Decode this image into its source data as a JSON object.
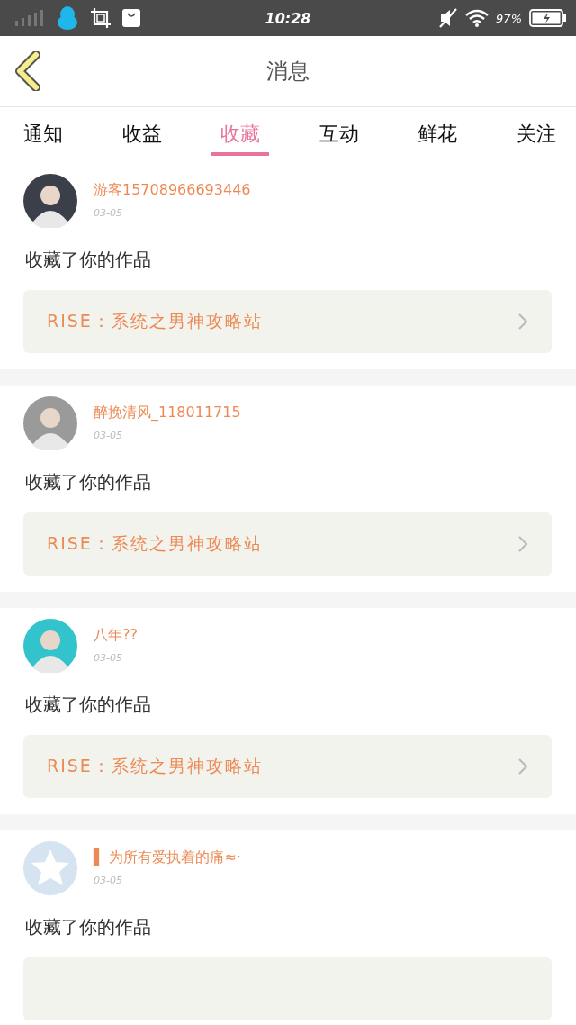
{
  "status_bar": {
    "time": "10:28",
    "battery_text": "97%"
  },
  "header": {
    "title": "消息"
  },
  "tabs": [
    {
      "label": "通知",
      "selected": false
    },
    {
      "label": "收益",
      "selected": false
    },
    {
      "label": "收藏",
      "selected": true
    },
    {
      "label": "互动",
      "selected": false
    },
    {
      "label": "鲜花",
      "selected": false
    },
    {
      "label": "关注",
      "selected": false
    }
  ],
  "messages": [
    {
      "avatar": {
        "kind": "photo",
        "color": "#3a3f4a"
      },
      "name": "游客15708966693446",
      "date": "03-05",
      "text": "收藏了你的作品",
      "link": "RISE：系统之男神攻略站"
    },
    {
      "avatar": {
        "kind": "photo",
        "color": "#9a9a9a"
      },
      "name": "醉挽清风_118011715",
      "date": "03-05",
      "text": "收藏了你的作品",
      "link": "RISE：系统之男神攻略站"
    },
    {
      "avatar": {
        "kind": "photo",
        "color": "#33c3cc"
      },
      "name": "八年??",
      "date": "03-05",
      "text": "收藏了你的作品",
      "link": "RISE：系统之男神攻略站"
    },
    {
      "avatar": {
        "kind": "default",
        "color": "#d6e3f0"
      },
      "name": "▌ 为所有爱执着的痛≈·",
      "date": "03-05",
      "text": "收藏了你的作品"
    }
  ]
}
